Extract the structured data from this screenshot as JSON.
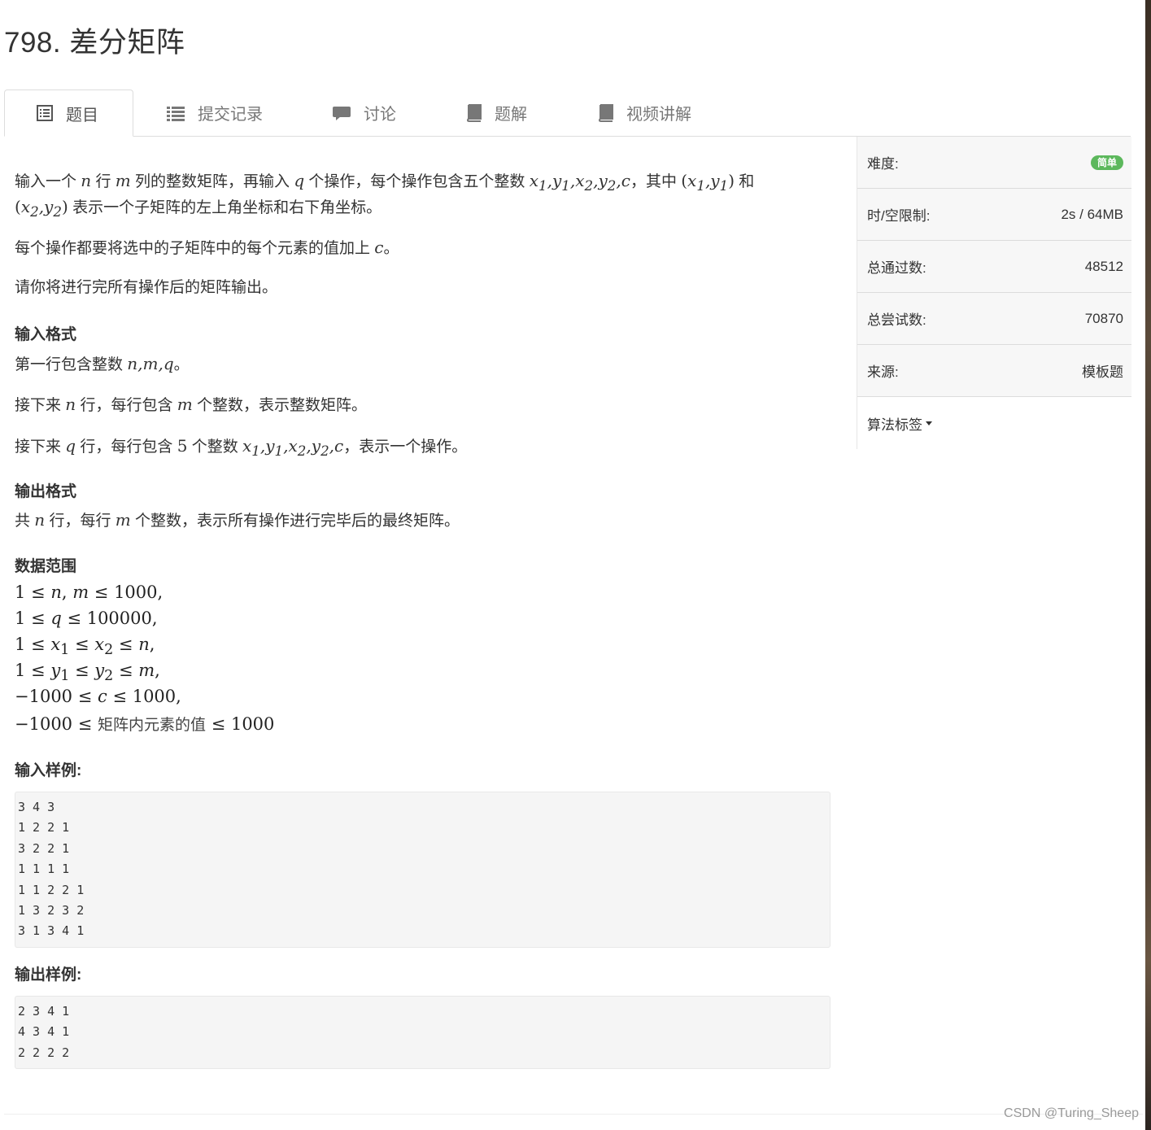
{
  "title": "798. 差分矩阵",
  "tabs": [
    {
      "label": "题目",
      "icon": "list-alt-icon"
    },
    {
      "label": "提交记录",
      "icon": "list-icon"
    },
    {
      "label": "讨论",
      "icon": "comment-icon"
    },
    {
      "label": "题解",
      "icon": "book-icon"
    },
    {
      "label": "视频讲解",
      "icon": "book-icon"
    }
  ],
  "problem": {
    "desc_line1_a": "输入一个",
    "desc_line1_b": "行",
    "desc_line1_c": "列的整数矩阵，再输入",
    "desc_line1_d": "个操作，每个操作包含五个整数",
    "desc_line1_e": "，其中",
    "desc_line1_f": "和",
    "desc_line2": "表示一个子矩阵的左上角坐标和右下角坐标。",
    "desc_p2": "每个操作都要将选中的子矩阵中的每个元素的值加上",
    "desc_p3": "请你将进行完所有操作后的矩阵输出。",
    "input_format_heading": "输入格式",
    "input_line1": "第一行包含整数",
    "input_line2_a": "接下来",
    "input_line2_b": "行，每行包含",
    "input_line2_c": "个整数，表示整数矩阵。",
    "input_line3_a": "接下来",
    "input_line3_b": "行，每行包含",
    "input_line3_c": "个整数",
    "input_line3_d": "，表示一个操作。",
    "output_format_heading": "输出格式",
    "output_line_a": "共",
    "output_line_b": "行，每行",
    "output_line_c": "个整数，表示所有操作进行完毕后的最终矩阵。",
    "range_heading": "数据范围",
    "range_cn": "矩阵内元素的值",
    "sample_in_heading": "输入样例:",
    "sample_in": [
      "3 4 3",
      "1 2 2 1",
      "3 2 2 1",
      "1 1 1 1",
      "1 1 2 2 1",
      "1 3 2 3 2",
      "3 1 3 4 1"
    ],
    "sample_out_heading": "输出样例:",
    "sample_out": [
      "2 3 4 1",
      "4 3 4 1",
      "2 2 2 2"
    ]
  },
  "info": {
    "difficulty_label": "难度:",
    "difficulty_value": "简单",
    "limit_label": "时/空限制:",
    "limit_value": "2s / 64MB",
    "passed_label": "总通过数:",
    "passed_value": "48512",
    "tried_label": "总尝试数:",
    "tried_value": "70870",
    "source_label": "来源:",
    "source_value": "模板题",
    "tags_label": "算法标签"
  },
  "watermark": "CSDN @Turing_Sheep",
  "colors": {
    "badge": "#5cb85c",
    "text": "#333333",
    "tab_inactive": "#777777",
    "panel_bg": "#f7f7f7"
  }
}
